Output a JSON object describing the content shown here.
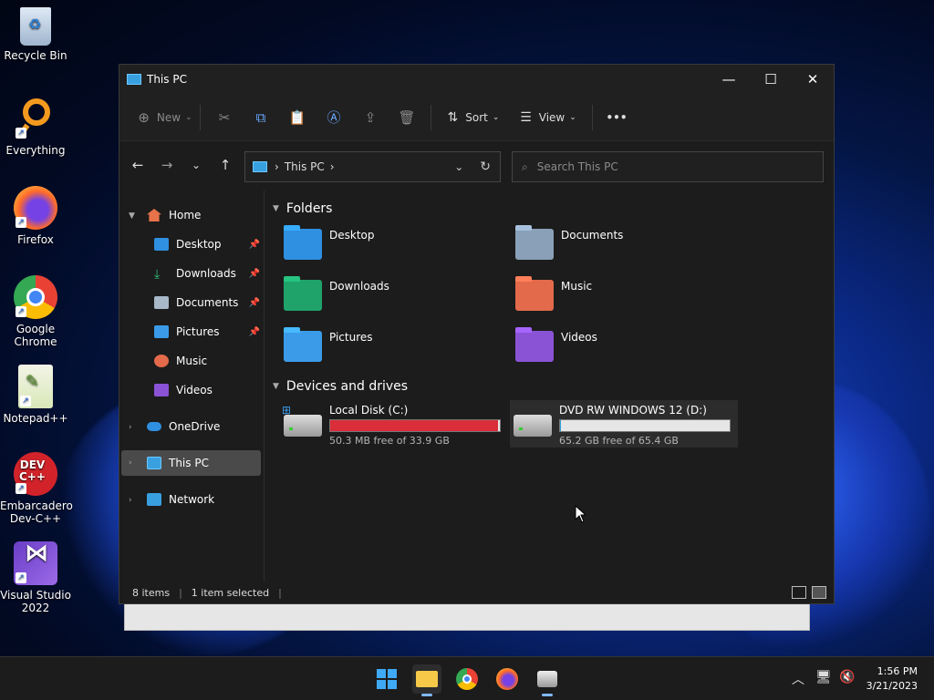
{
  "desktop": {
    "icons": [
      {
        "label": "Recycle Bin"
      },
      {
        "label": "Everything"
      },
      {
        "label": "Firefox"
      },
      {
        "label": "Google Chrome"
      },
      {
        "label": "Notepad++"
      },
      {
        "label": "Embarcadero Dev-C++"
      },
      {
        "label": "Visual Studio 2022"
      }
    ]
  },
  "window": {
    "title": "This PC",
    "controls": {
      "minimize": "—",
      "maximize": "☐",
      "close": "✕"
    }
  },
  "toolbar": {
    "new_label": "New",
    "sort_label": "Sort",
    "view_label": "View",
    "more_label": "•••"
  },
  "navigation": {
    "address_crumb": "This PC",
    "search_placeholder": "Search This PC"
  },
  "sidebar": {
    "home": "Home",
    "items": [
      {
        "label": "Desktop"
      },
      {
        "label": "Downloads"
      },
      {
        "label": "Documents"
      },
      {
        "label": "Pictures"
      },
      {
        "label": "Music"
      },
      {
        "label": "Videos"
      }
    ],
    "onedrive": "OneDrive",
    "this_pc": "This PC",
    "network": "Network"
  },
  "content": {
    "folders_header": "Folders",
    "folders": [
      {
        "label": "Desktop",
        "color": "#2f8fe0"
      },
      {
        "label": "Documents",
        "color": "#8aa0b8"
      },
      {
        "label": "Downloads",
        "color": "#1fa36b"
      },
      {
        "label": "Music",
        "color": "#e36a4a"
      },
      {
        "label": "Pictures",
        "color": "#3b9be8"
      },
      {
        "label": "Videos",
        "color": "#8a53d6"
      }
    ],
    "drives_header": "Devices and drives",
    "drives": [
      {
        "name": "Local Disk (C:)",
        "free": "50.3 MB free of 33.9 GB",
        "used_fraction": 0.99,
        "bar_color": "#da2e3a"
      },
      {
        "name": "DVD RW WINDOWS 12 (D:)",
        "free": "65.2 GB free of 65.4 GB",
        "used_fraction": 0.003,
        "bar_color": "#26a0da"
      }
    ]
  },
  "status": {
    "items": "8 items",
    "selected": "1 item selected"
  },
  "taskbar": {
    "time": "1:56 PM",
    "date": "3/21/2023"
  }
}
